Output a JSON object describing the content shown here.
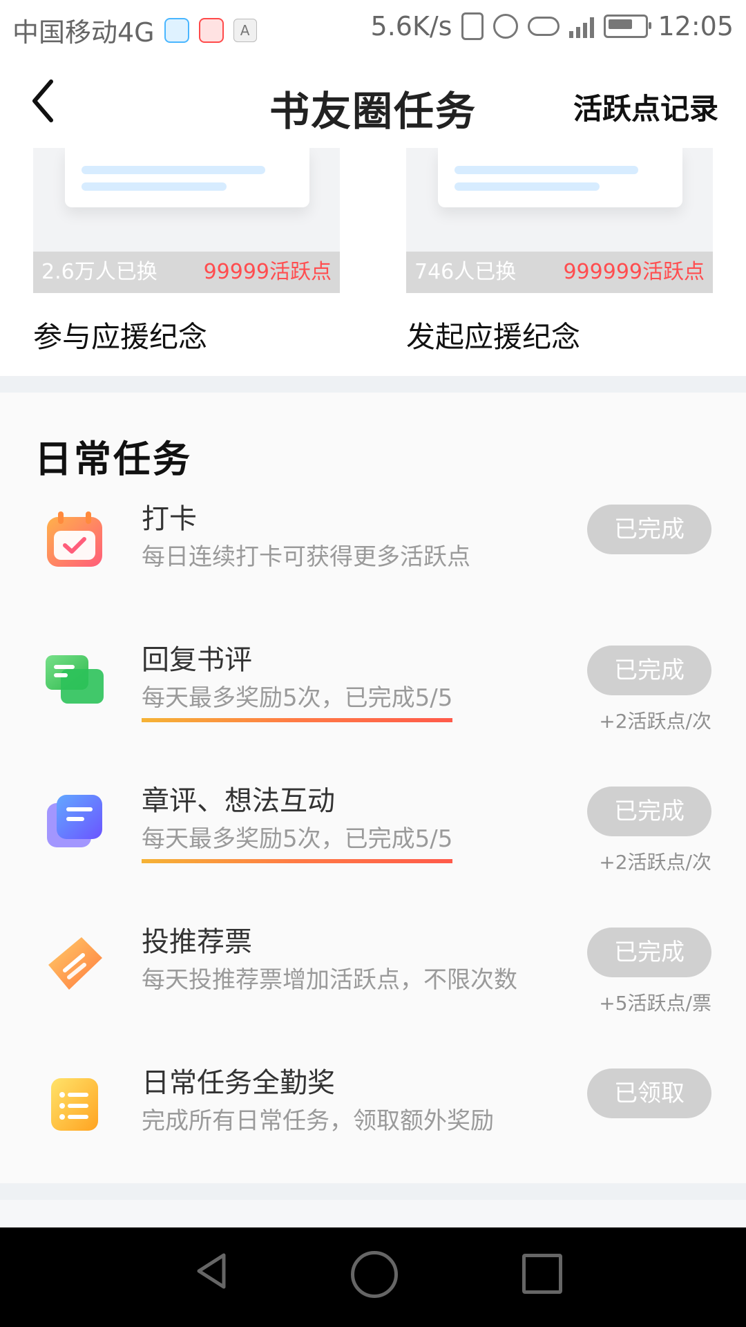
{
  "status_bar": {
    "carrier": "中国移动4G",
    "net_speed": "5.6K/s",
    "time": "12:05",
    "icons": [
      "browser-icon",
      "qq-icon",
      "a-icon",
      "vibrate-icon",
      "alarm-icon",
      "eye-icon",
      "signal-icon",
      "battery-icon"
    ]
  },
  "nav": {
    "title": "书友圈任务",
    "right_action": "活跃点记录"
  },
  "top_cards": [
    {
      "count": "2.6万人已换",
      "points": "99999活跃点",
      "caption": "参与应援纪念"
    },
    {
      "count": "746人已换",
      "points": "999999活跃点",
      "caption": "发起应援纪念"
    }
  ],
  "daily": {
    "title": "日常任务",
    "tasks": [
      {
        "name": "打卡",
        "desc": "每日连续打卡可获得更多活跃点",
        "button": "已完成",
        "reward": "",
        "icon": "calendar-check-icon"
      },
      {
        "name": "回复书评",
        "desc": "每天最多奖励5次，已完成5/5",
        "button": "已完成",
        "reward": "+2活跃点/次",
        "icon": "chat-bubbles-icon"
      },
      {
        "name": "章评、想法互动",
        "desc": "每天最多奖励5次，已完成5/5",
        "button": "已完成",
        "reward": "+2活跃点/次",
        "icon": "notes-icon"
      },
      {
        "name": "投推荐票",
        "desc": "每天投推荐票增加活跃点，不限次数",
        "button": "已完成",
        "reward": "+5活跃点/票",
        "icon": "ticket-icon"
      },
      {
        "name": "日常任务全勤奖",
        "desc": "完成所有日常任务，领取额外奖励",
        "button": "已领取",
        "reward": "",
        "icon": "list-icon"
      }
    ]
  },
  "colors": {
    "points_red": "#ff4d4f",
    "button_gray": "#d0d0d0",
    "underline_start": "#f5b335",
    "underline_end": "#ff5a4a"
  }
}
